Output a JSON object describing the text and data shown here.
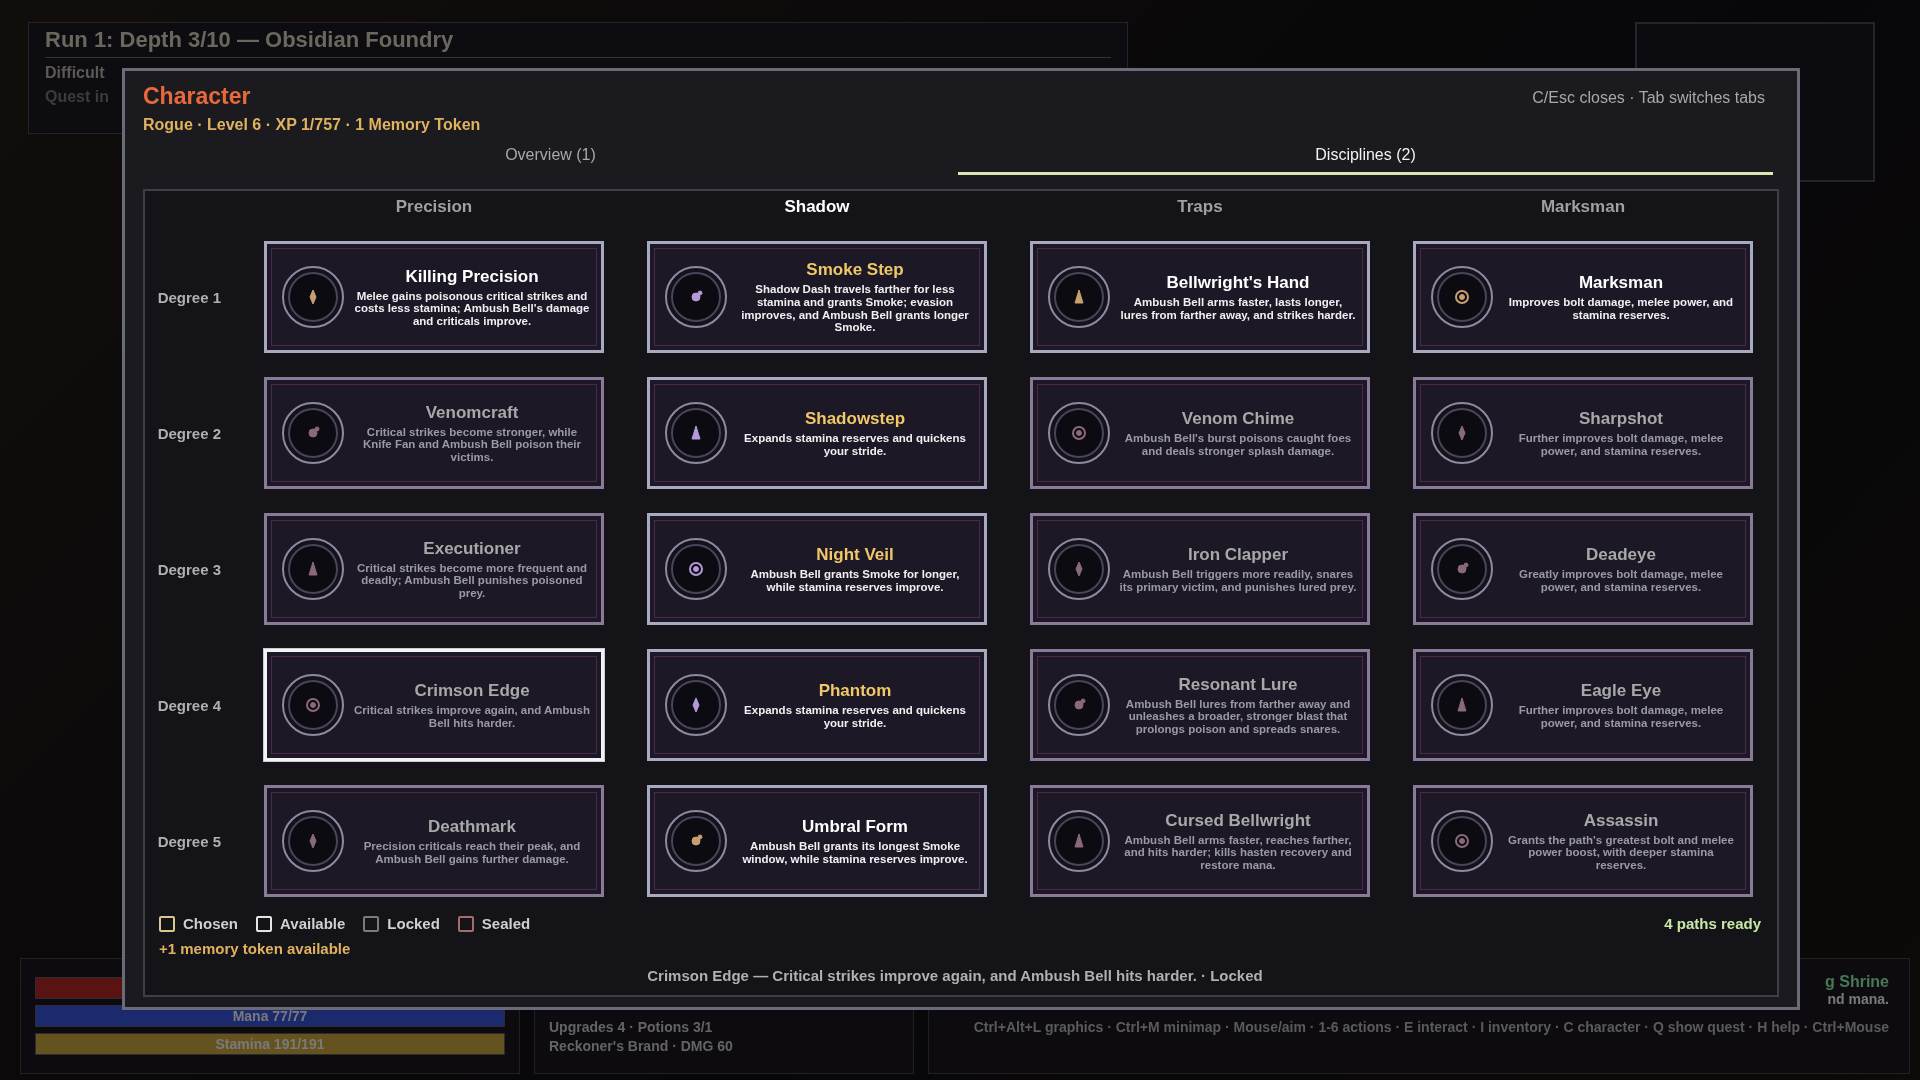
{
  "hud": {
    "run_title": "Run 1: Depth 3/10 — Obsidian Foundry",
    "difficulty": "Difficult",
    "quest": "Quest in",
    "health": {
      "level": 1
    },
    "mana": {
      "label": "Mana 77/77",
      "level": 1
    },
    "stamina": {
      "label": "Stamina 191/191",
      "level": 1
    },
    "stats": [
      "Upgrades 4 · Potions 3/1",
      "Reckoner's Brand · DMG 60"
    ],
    "shrine": "g Shrine",
    "shrine_note": "nd mana.",
    "controls": "Ctrl+Alt+L graphics · Ctrl+M minimap · Mouse/aim · 1-6 actions · E interact · I inventory · C character · Q show quest · H help · Ctrl+Mouse"
  },
  "window": {
    "title": "Character",
    "hint": "C/Esc closes · Tab switches tabs",
    "subtitle": "Rogue · Level 6 · XP 1/757 · 1 Memory Token"
  },
  "tabs": [
    {
      "label": "Overview (1)",
      "selected": false
    },
    {
      "label": "Disciplines (2)",
      "selected": true
    }
  ],
  "columns": [
    {
      "label": "Precision",
      "selected": false
    },
    {
      "label": "Shadow",
      "selected": true
    },
    {
      "label": "Traps",
      "selected": false
    },
    {
      "label": "Marksman",
      "selected": false
    }
  ],
  "rows": [
    {
      "label": "Degree 1",
      "cards": [
        {
          "title": "Killing Precision",
          "description": "Melee gains poisonous critical strikes and costs less stamina; Ambush Bell's damage and criticals improve.",
          "chosen": false,
          "locked": false,
          "selected": false
        },
        {
          "title": "Smoke Step",
          "description": "Shadow Dash travels farther for less stamina and grants Smoke; evasion improves, and Ambush Bell grants longer Smoke.",
          "chosen": true,
          "locked": false,
          "selected": false
        },
        {
          "title": "Bellwright's Hand",
          "description": "Ambush Bell arms faster, lasts longer, lures from farther away, and strikes harder.",
          "chosen": false,
          "locked": false,
          "selected": false
        },
        {
          "title": "Marksman",
          "description": "Improves bolt damage, melee power, and stamina reserves.",
          "chosen": false,
          "locked": false,
          "selected": false
        }
      ]
    },
    {
      "label": "Degree 2",
      "cards": [
        {
          "title": "Venomcraft",
          "description": "Critical strikes become stronger, while Knife Fan and Ambush Bell poison their victims.",
          "chosen": false,
          "locked": true,
          "selected": false
        },
        {
          "title": "Shadowstep",
          "description": "Expands stamina reserves and quickens your stride.",
          "chosen": true,
          "locked": false,
          "selected": false
        },
        {
          "title": "Venom Chime",
          "description": "Ambush Bell's burst poisons caught foes and deals stronger splash damage.",
          "chosen": false,
          "locked": true,
          "selected": false
        },
        {
          "title": "Sharpshot",
          "description": "Further improves bolt damage, melee power, and stamina reserves.",
          "chosen": false,
          "locked": true,
          "selected": false
        }
      ]
    },
    {
      "label": "Degree 3",
      "cards": [
        {
          "title": "Executioner",
          "description": "Critical strikes become more frequent and deadly; Ambush Bell punishes poisoned prey.",
          "chosen": false,
          "locked": true,
          "selected": false
        },
        {
          "title": "Night Veil",
          "description": "Ambush Bell grants Smoke for longer, while stamina reserves improve.",
          "chosen": true,
          "locked": false,
          "selected": false
        },
        {
          "title": "Iron Clapper",
          "description": "Ambush Bell triggers more readily, snares its primary victim, and punishes lured prey.",
          "chosen": false,
          "locked": true,
          "selected": false
        },
        {
          "title": "Deadeye",
          "description": "Greatly improves bolt damage, melee power, and stamina reserves.",
          "chosen": false,
          "locked": true,
          "selected": false
        }
      ]
    },
    {
      "label": "Degree 4",
      "cards": [
        {
          "title": "Crimson Edge",
          "description": "Critical strikes improve again, and Ambush Bell hits harder.",
          "chosen": false,
          "locked": true,
          "selected": true
        },
        {
          "title": "Phantom",
          "description": "Expands stamina reserves and quickens your stride.",
          "chosen": true,
          "locked": false,
          "selected": false
        },
        {
          "title": "Resonant Lure",
          "description": "Ambush Bell lures from farther away and unleashes a broader, stronger blast that prolongs poison and spreads snares.",
          "chosen": false,
          "locked": true,
          "selected": false
        },
        {
          "title": "Eagle Eye",
          "description": "Further improves bolt damage, melee power, and stamina reserves.",
          "chosen": false,
          "locked": true,
          "selected": false
        }
      ]
    },
    {
      "label": "Degree 5",
      "cards": [
        {
          "title": "Deathmark",
          "description": "Precision criticals reach their peak, and Ambush Bell gains further damage.",
          "chosen": false,
          "locked": true,
          "selected": false
        },
        {
          "title": "Umbral Form",
          "description": "Ambush Bell grants its longest Smoke window, while stamina reserves improve.",
          "chosen": false,
          "locked": false,
          "selected": false
        },
        {
          "title": "Cursed Bellwright",
          "description": "Ambush Bell arms faster, reaches farther, and hits harder; kills hasten recovery and restore mana.",
          "chosen": false,
          "locked": true,
          "selected": false
        },
        {
          "title": "Assassin",
          "description": "Grants the path's greatest bolt and melee power boost, with deeper stamina reserves.",
          "chosen": false,
          "locked": true,
          "selected": false
        }
      ]
    }
  ],
  "legend": [
    {
      "label": "Chosen",
      "color": "#d8c890"
    },
    {
      "label": "Available",
      "color": "#e4e4e4"
    },
    {
      "label": "Locked",
      "color": "#7a7a7a"
    },
    {
      "label": "Sealed",
      "color": "#a86a6a"
    }
  ],
  "memory_note": "+1 memory token available",
  "paths_ready": "4 paths ready",
  "status": "Crimson Edge — Critical strikes improve again, and Ambush Bell hits harder. · Locked"
}
